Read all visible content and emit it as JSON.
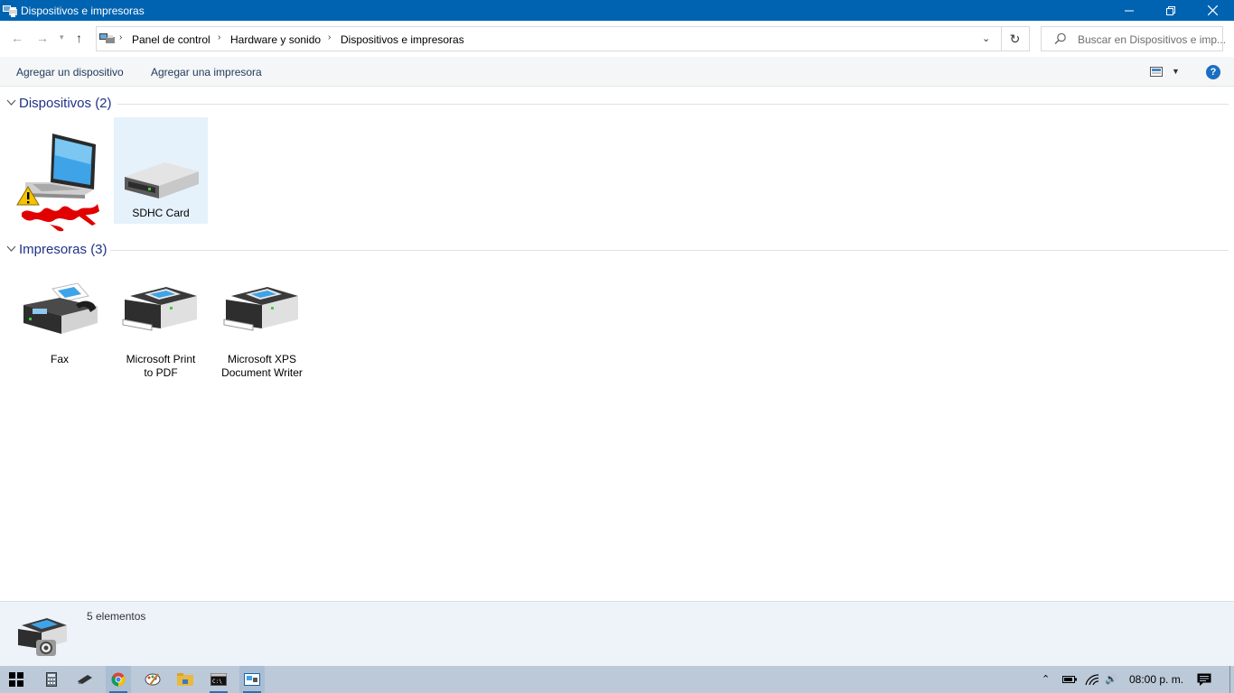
{
  "window": {
    "title": "Dispositivos e impresoras",
    "icon": "devices-printers-icon"
  },
  "address": {
    "crumbs": [
      "Panel de control",
      "Hardware y sonido",
      "Dispositivos e impresoras"
    ],
    "search_placeholder": "Buscar en Dispositivos e imp..."
  },
  "toolbar": {
    "add_device": "Agregar un dispositivo",
    "add_printer": "Agregar una impresora",
    "help": "?"
  },
  "groups": {
    "devices": {
      "title": "Dispositivos (2)",
      "items": [
        {
          "label": "",
          "icon": "laptop-icon",
          "status": "warning",
          "note": "name obscured by red scribble"
        },
        {
          "label": "SDHC Card",
          "icon": "sd-card-reader-icon",
          "selected": true
        }
      ]
    },
    "printers": {
      "title": "Impresoras (3)",
      "items": [
        {
          "label": "Fax",
          "icon": "fax-icon"
        },
        {
          "label_line1": "Microsoft Print",
          "label_line2": "to PDF",
          "icon": "printer-icon"
        },
        {
          "label_line1": "Microsoft XPS",
          "label_line2": "Document Writer",
          "icon": "printer-icon"
        }
      ]
    }
  },
  "status": {
    "count": "5 elementos"
  },
  "taskbar": {
    "items": [
      "start-icon",
      "calculator-icon",
      "pen-icon",
      "chrome-icon",
      "paint-icon",
      "file-explorer-icon",
      "cmd-icon",
      "devices-printers-icon"
    ],
    "clock": "08:00 p. m."
  },
  "colors": {
    "titlebar": "#0063b1",
    "group_title": "#1e3287",
    "selection": "#e5f1fb",
    "warning": "#f5c400"
  }
}
